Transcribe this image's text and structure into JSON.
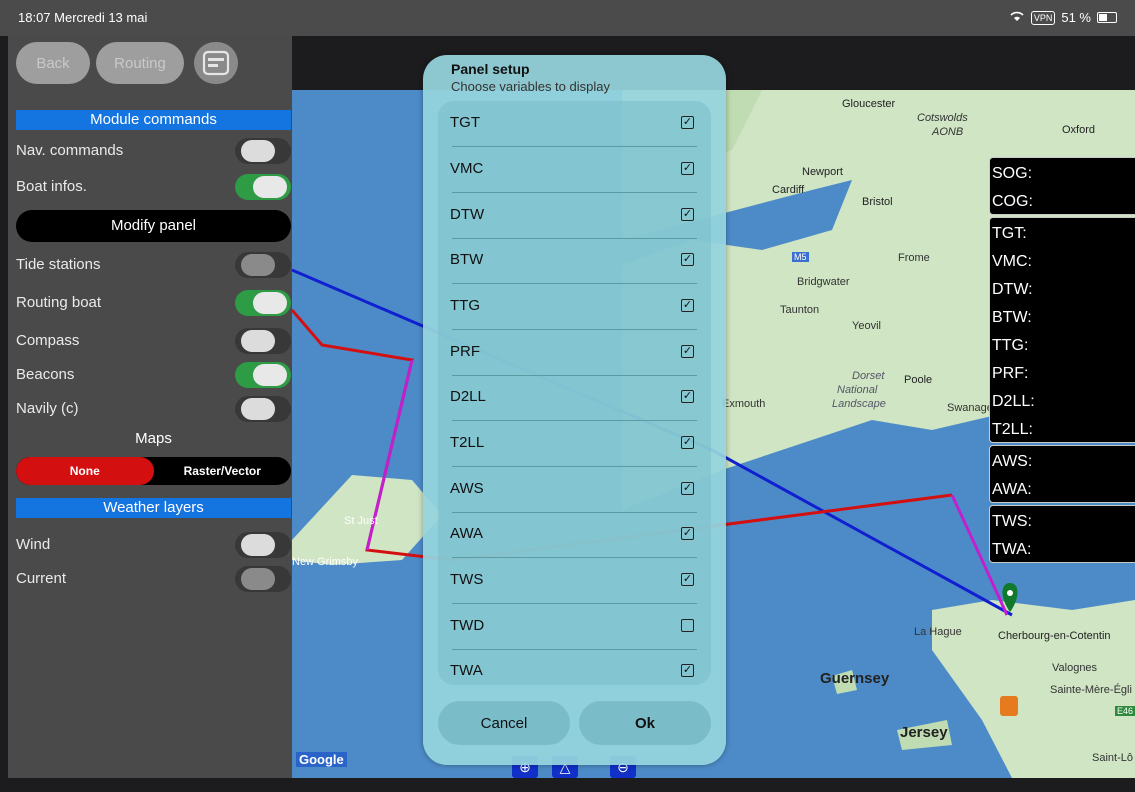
{
  "status_bar": {
    "time_date": "18:07  Mercredi 13 mai",
    "vpn": "VPN",
    "battery": "51 %"
  },
  "top_buttons": {
    "back": "Back",
    "routing": "Routing",
    "panel_icon": "panel-icon"
  },
  "module_commands": {
    "header": "Module commands",
    "rows": [
      {
        "label": "Nav. commands",
        "state": "off"
      },
      {
        "label": "Boat infos.",
        "state": "on"
      }
    ],
    "modify_panel": "Modify panel",
    "rows2": [
      {
        "label": "Tide stations",
        "state": "disabled"
      },
      {
        "label": "Routing boat",
        "state": "on"
      },
      {
        "label": "Compass",
        "state": "off"
      },
      {
        "label": "Beacons",
        "state": "on"
      },
      {
        "label": "Navily (c)",
        "state": "off"
      }
    ]
  },
  "maps": {
    "label": "Maps",
    "options": [
      "None",
      "Raster/Vector"
    ],
    "selected": "None"
  },
  "weather_layers": {
    "header": "Weather layers",
    "rows": [
      {
        "label": "Wind",
        "state": "off"
      },
      {
        "label": "Current",
        "state": "disabled"
      }
    ]
  },
  "map_labels": [
    "Gloucester",
    "Cotswolds",
    "AONB",
    "Oxford",
    "Newport",
    "Cardiff",
    "Bristol",
    "Frome",
    "Bridgwater",
    "Taunton",
    "Yeovil",
    "Dorset",
    "National",
    "Landscape",
    "Poole",
    "Exmouth",
    "Swanage",
    "St Just",
    "New Grimsby",
    "La Hague",
    "Cherbourg-en-Cotentin",
    "Valognes",
    "Guernsey",
    "Sainte-Mère-Égli",
    "Jersey",
    "Saint-Lô",
    "Google",
    "M5",
    "E46"
  ],
  "nav_panel": [
    {
      "labels": [
        "SOG:",
        "COG:"
      ]
    },
    {
      "labels": [
        "TGT:",
        "VMC:",
        "DTW:",
        "BTW:",
        "TTG:",
        "PRF:",
        "D2LL:",
        "T2LL:"
      ]
    },
    {
      "labels": [
        "AWS:",
        "AWA:"
      ]
    },
    {
      "labels": [
        "TWS:",
        "TWA:"
      ]
    }
  ],
  "dialog": {
    "title": "Panel setup",
    "subtitle": "Choose variables to display",
    "items": [
      {
        "name": "TGT",
        "checked": true
      },
      {
        "name": "VMC",
        "checked": true
      },
      {
        "name": "DTW",
        "checked": true
      },
      {
        "name": "BTW",
        "checked": true
      },
      {
        "name": "TTG",
        "checked": true
      },
      {
        "name": "PRF",
        "checked": true
      },
      {
        "name": "D2LL",
        "checked": true
      },
      {
        "name": "T2LL",
        "checked": true
      },
      {
        "name": "AWS",
        "checked": true
      },
      {
        "name": "AWA",
        "checked": true
      },
      {
        "name": "TWS",
        "checked": true
      },
      {
        "name": "TWD",
        "checked": false
      },
      {
        "name": "TWA",
        "checked": true
      }
    ],
    "cancel": "Cancel",
    "ok": "Ok"
  },
  "colors": {
    "accent_blue": "#1474e0",
    "toggle_on": "#2e9c45",
    "route_red": "#d40f10",
    "route_blue": "#1020d0",
    "route_magenta": "#c21fd0"
  }
}
